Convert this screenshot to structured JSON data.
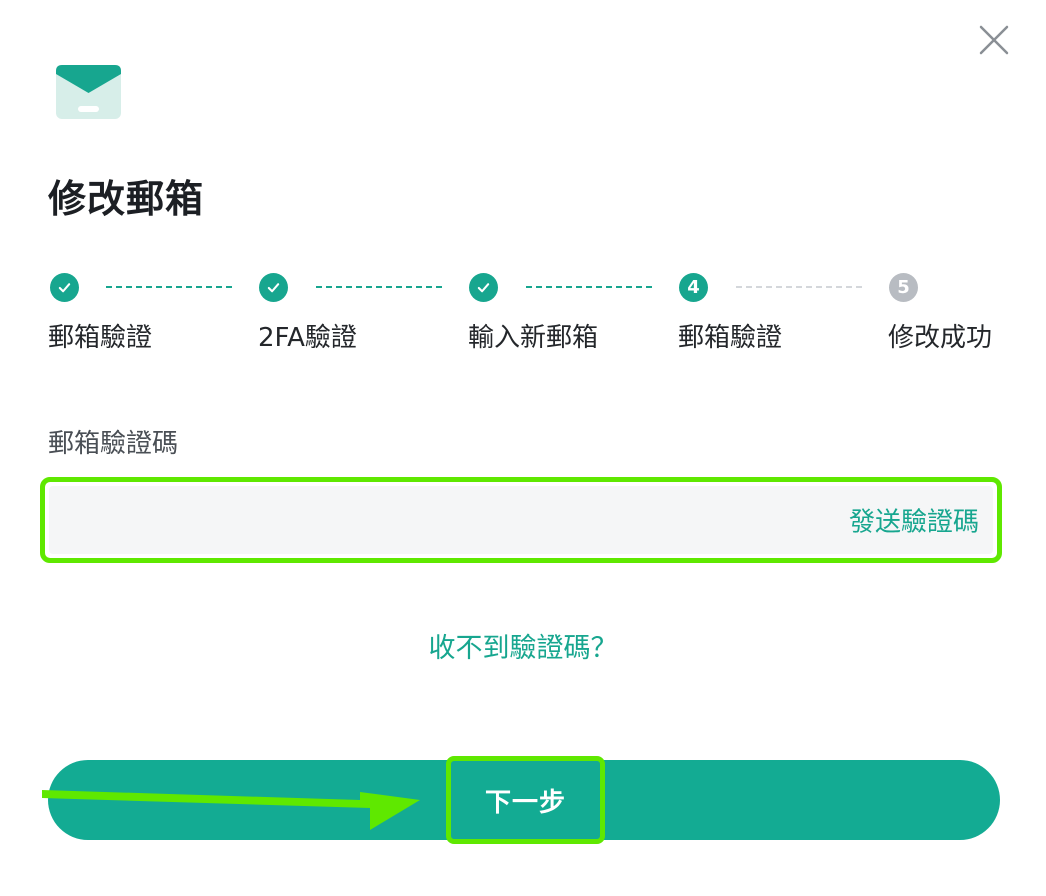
{
  "dialog": {
    "title": "修改郵箱",
    "close_icon": "close-icon",
    "mail_icon": "mail-icon"
  },
  "steps": [
    {
      "label": "郵箱驗證",
      "state": "done"
    },
    {
      "label": "2FA驗證",
      "state": "done"
    },
    {
      "label": "輸入新郵箱",
      "state": "done"
    },
    {
      "label": "郵箱驗證",
      "state": "active",
      "number": "4"
    },
    {
      "label": "修改成功",
      "state": "pending",
      "number": "5"
    }
  ],
  "form": {
    "code_label": "郵箱驗證碼",
    "code_value": "",
    "send_code": "發送驗證碼",
    "no_code": "收不到驗證碼？",
    "next": "下一步"
  },
  "colors": {
    "accent": "#17a68f",
    "highlight": "#5fe800",
    "pending": "#b8bcc2"
  }
}
